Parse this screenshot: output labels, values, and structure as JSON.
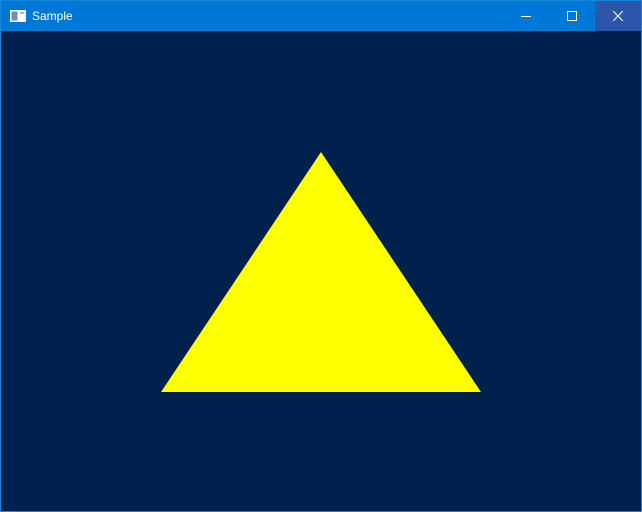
{
  "window": {
    "title": "Sample",
    "icon": "app-window-icon"
  },
  "caption_buttons": {
    "minimize_icon": "minimize-icon",
    "maximize_icon": "maximize-icon",
    "close_icon": "close-icon"
  },
  "colors": {
    "titlebar": "#0078d7",
    "close_button": "#2b56a9",
    "clear_color": "#00214d",
    "triangle": "#ffff00"
  },
  "scene": {
    "shape": "triangle"
  }
}
